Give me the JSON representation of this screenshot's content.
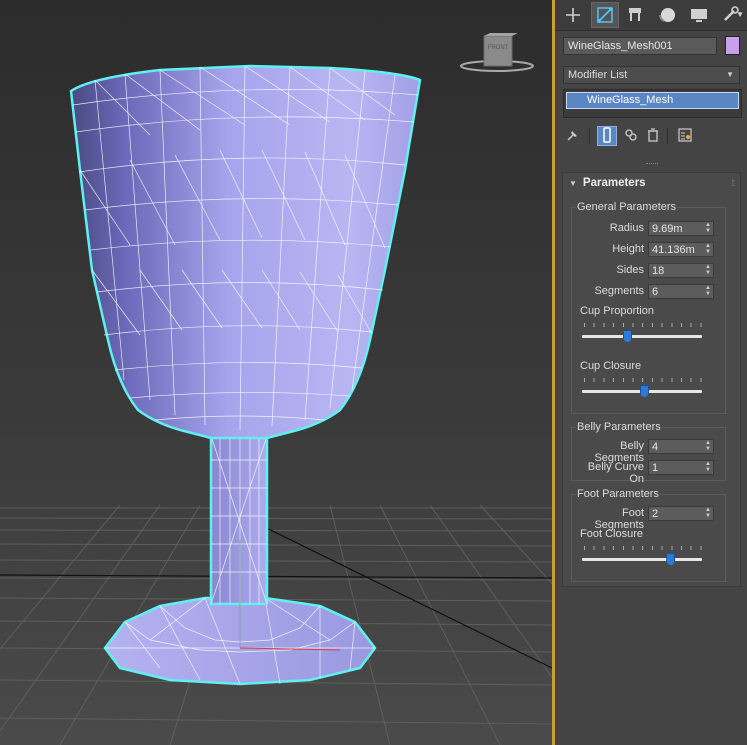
{
  "viewport": {
    "viewcube_label": "FRONT"
  },
  "command_panel": {
    "tabs": [
      {
        "icon": "create-plus-icon"
      },
      {
        "icon": "modify-icon"
      },
      {
        "icon": "hierarchy-icon"
      },
      {
        "icon": "motion-icon"
      },
      {
        "icon": "display-icon"
      },
      {
        "icon": "utilities-icon"
      }
    ],
    "object_name": "WineGlass_Mesh001",
    "object_color": "#c8a0ee",
    "modifier_list_label": "Modifier List",
    "modifier_stack": [
      "WineGlass_Mesh"
    ]
  },
  "parameters": {
    "rollout_title": "Parameters",
    "general": {
      "title": "General Parameters",
      "radius_label": "Radius",
      "radius_value": "9.69m",
      "height_label": "Height",
      "height_value": "41.136m",
      "sides_label": "Sides",
      "sides_value": "18",
      "segments_label": "Segments",
      "segments_value": "6",
      "cup_proportion_label": "Cup Proportion",
      "cup_proportion_value": 0.38,
      "cup_closure_label": "Cup Closure",
      "cup_closure_value": 0.52
    },
    "belly": {
      "title": "Belly Parameters",
      "segments_label": "Belly Segments",
      "segments_value": "4",
      "curve_label": "Belly Curve On",
      "curve_value": "1"
    },
    "foot": {
      "title": "Foot Parameters",
      "segments_label": "Foot Segments",
      "segments_value": "2",
      "closure_label": "Foot Closure",
      "closure_value": 0.74
    }
  },
  "colors": {
    "selection_outline": "#5ff0f0",
    "mesh_fill": "#a9a6ee",
    "accent_blue": "#5b86c4",
    "viewport_border": "#c9a22e"
  }
}
